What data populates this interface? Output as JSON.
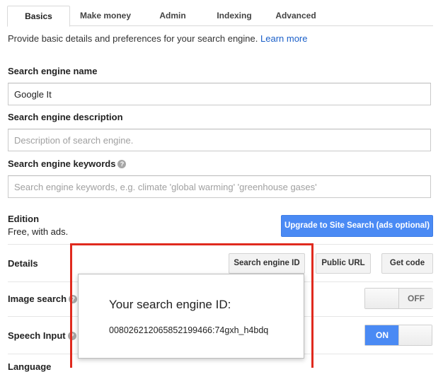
{
  "tabs": [
    {
      "label": "Basics",
      "active": true
    },
    {
      "label": "Make money",
      "active": false
    },
    {
      "label": "Admin",
      "active": false
    },
    {
      "label": "Indexing",
      "active": false
    },
    {
      "label": "Advanced",
      "active": false
    }
  ],
  "intro": {
    "text": "Provide basic details and preferences for your search engine.",
    "link": "Learn more"
  },
  "name": {
    "label": "Search engine name",
    "value": "Google It"
  },
  "description": {
    "label": "Search engine description",
    "placeholder": "Description of search engine."
  },
  "keywords": {
    "label": "Search engine keywords",
    "placeholder": "Search engine keywords, e.g. climate 'global warming' 'greenhouse gases'"
  },
  "edition": {
    "label": "Edition",
    "value": "Free, with ads.",
    "upgrade_button": "Upgrade to Site Search (ads optional)"
  },
  "details": {
    "label": "Details",
    "buttons": [
      "Search engine ID",
      "Public URL",
      "Get code"
    ]
  },
  "image_search": {
    "label": "Image search",
    "state": "OFF"
  },
  "speech_input": {
    "label": "Speech Input",
    "state": "ON"
  },
  "language": {
    "label": "Language"
  },
  "popup": {
    "title": "Your search engine ID:",
    "id": "008026212065852199466:74gxh_h4bdq"
  },
  "colors": {
    "accent": "#4a8af4",
    "link": "#1a5fc9",
    "highlight": "#e02a1e"
  }
}
